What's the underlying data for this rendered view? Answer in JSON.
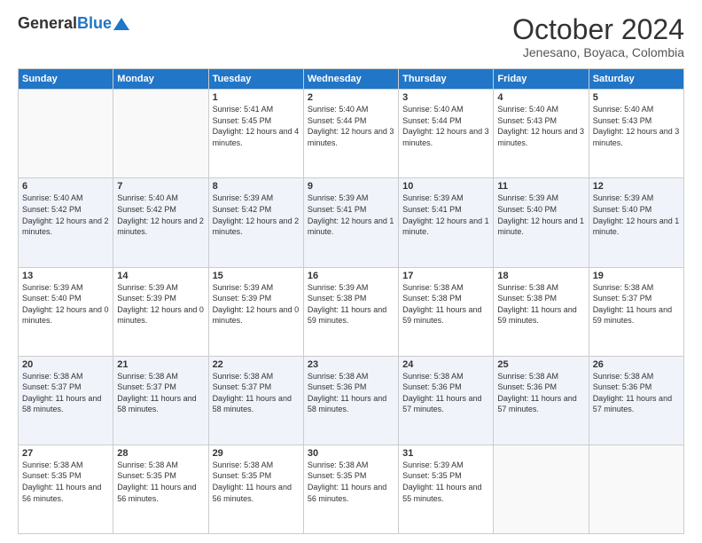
{
  "header": {
    "logo_general": "General",
    "logo_blue": "Blue",
    "month": "October 2024",
    "location": "Jenesano, Boyaca, Colombia"
  },
  "days_of_week": [
    "Sunday",
    "Monday",
    "Tuesday",
    "Wednesday",
    "Thursday",
    "Friday",
    "Saturday"
  ],
  "weeks": [
    [
      {
        "num": "",
        "detail": ""
      },
      {
        "num": "",
        "detail": ""
      },
      {
        "num": "1",
        "detail": "Sunrise: 5:41 AM\nSunset: 5:45 PM\nDaylight: 12 hours\nand 4 minutes."
      },
      {
        "num": "2",
        "detail": "Sunrise: 5:40 AM\nSunset: 5:44 PM\nDaylight: 12 hours\nand 3 minutes."
      },
      {
        "num": "3",
        "detail": "Sunrise: 5:40 AM\nSunset: 5:44 PM\nDaylight: 12 hours\nand 3 minutes."
      },
      {
        "num": "4",
        "detail": "Sunrise: 5:40 AM\nSunset: 5:43 PM\nDaylight: 12 hours\nand 3 minutes."
      },
      {
        "num": "5",
        "detail": "Sunrise: 5:40 AM\nSunset: 5:43 PM\nDaylight: 12 hours\nand 3 minutes."
      }
    ],
    [
      {
        "num": "6",
        "detail": "Sunrise: 5:40 AM\nSunset: 5:42 PM\nDaylight: 12 hours\nand 2 minutes."
      },
      {
        "num": "7",
        "detail": "Sunrise: 5:40 AM\nSunset: 5:42 PM\nDaylight: 12 hours\nand 2 minutes."
      },
      {
        "num": "8",
        "detail": "Sunrise: 5:39 AM\nSunset: 5:42 PM\nDaylight: 12 hours\nand 2 minutes."
      },
      {
        "num": "9",
        "detail": "Sunrise: 5:39 AM\nSunset: 5:41 PM\nDaylight: 12 hours\nand 1 minute."
      },
      {
        "num": "10",
        "detail": "Sunrise: 5:39 AM\nSunset: 5:41 PM\nDaylight: 12 hours\nand 1 minute."
      },
      {
        "num": "11",
        "detail": "Sunrise: 5:39 AM\nSunset: 5:40 PM\nDaylight: 12 hours\nand 1 minute."
      },
      {
        "num": "12",
        "detail": "Sunrise: 5:39 AM\nSunset: 5:40 PM\nDaylight: 12 hours\nand 1 minute."
      }
    ],
    [
      {
        "num": "13",
        "detail": "Sunrise: 5:39 AM\nSunset: 5:40 PM\nDaylight: 12 hours\nand 0 minutes."
      },
      {
        "num": "14",
        "detail": "Sunrise: 5:39 AM\nSunset: 5:39 PM\nDaylight: 12 hours\nand 0 minutes."
      },
      {
        "num": "15",
        "detail": "Sunrise: 5:39 AM\nSunset: 5:39 PM\nDaylight: 12 hours\nand 0 minutes."
      },
      {
        "num": "16",
        "detail": "Sunrise: 5:39 AM\nSunset: 5:38 PM\nDaylight: 11 hours\nand 59 minutes."
      },
      {
        "num": "17",
        "detail": "Sunrise: 5:38 AM\nSunset: 5:38 PM\nDaylight: 11 hours\nand 59 minutes."
      },
      {
        "num": "18",
        "detail": "Sunrise: 5:38 AM\nSunset: 5:38 PM\nDaylight: 11 hours\nand 59 minutes."
      },
      {
        "num": "19",
        "detail": "Sunrise: 5:38 AM\nSunset: 5:37 PM\nDaylight: 11 hours\nand 59 minutes."
      }
    ],
    [
      {
        "num": "20",
        "detail": "Sunrise: 5:38 AM\nSunset: 5:37 PM\nDaylight: 11 hours\nand 58 minutes."
      },
      {
        "num": "21",
        "detail": "Sunrise: 5:38 AM\nSunset: 5:37 PM\nDaylight: 11 hours\nand 58 minutes."
      },
      {
        "num": "22",
        "detail": "Sunrise: 5:38 AM\nSunset: 5:37 PM\nDaylight: 11 hours\nand 58 minutes."
      },
      {
        "num": "23",
        "detail": "Sunrise: 5:38 AM\nSunset: 5:36 PM\nDaylight: 11 hours\nand 58 minutes."
      },
      {
        "num": "24",
        "detail": "Sunrise: 5:38 AM\nSunset: 5:36 PM\nDaylight: 11 hours\nand 57 minutes."
      },
      {
        "num": "25",
        "detail": "Sunrise: 5:38 AM\nSunset: 5:36 PM\nDaylight: 11 hours\nand 57 minutes."
      },
      {
        "num": "26",
        "detail": "Sunrise: 5:38 AM\nSunset: 5:36 PM\nDaylight: 11 hours\nand 57 minutes."
      }
    ],
    [
      {
        "num": "27",
        "detail": "Sunrise: 5:38 AM\nSunset: 5:35 PM\nDaylight: 11 hours\nand 56 minutes."
      },
      {
        "num": "28",
        "detail": "Sunrise: 5:38 AM\nSunset: 5:35 PM\nDaylight: 11 hours\nand 56 minutes."
      },
      {
        "num": "29",
        "detail": "Sunrise: 5:38 AM\nSunset: 5:35 PM\nDaylight: 11 hours\nand 56 minutes."
      },
      {
        "num": "30",
        "detail": "Sunrise: 5:38 AM\nSunset: 5:35 PM\nDaylight: 11 hours\nand 56 minutes."
      },
      {
        "num": "31",
        "detail": "Sunrise: 5:39 AM\nSunset: 5:35 PM\nDaylight: 11 hours\nand 55 minutes."
      },
      {
        "num": "",
        "detail": ""
      },
      {
        "num": "",
        "detail": ""
      }
    ]
  ]
}
